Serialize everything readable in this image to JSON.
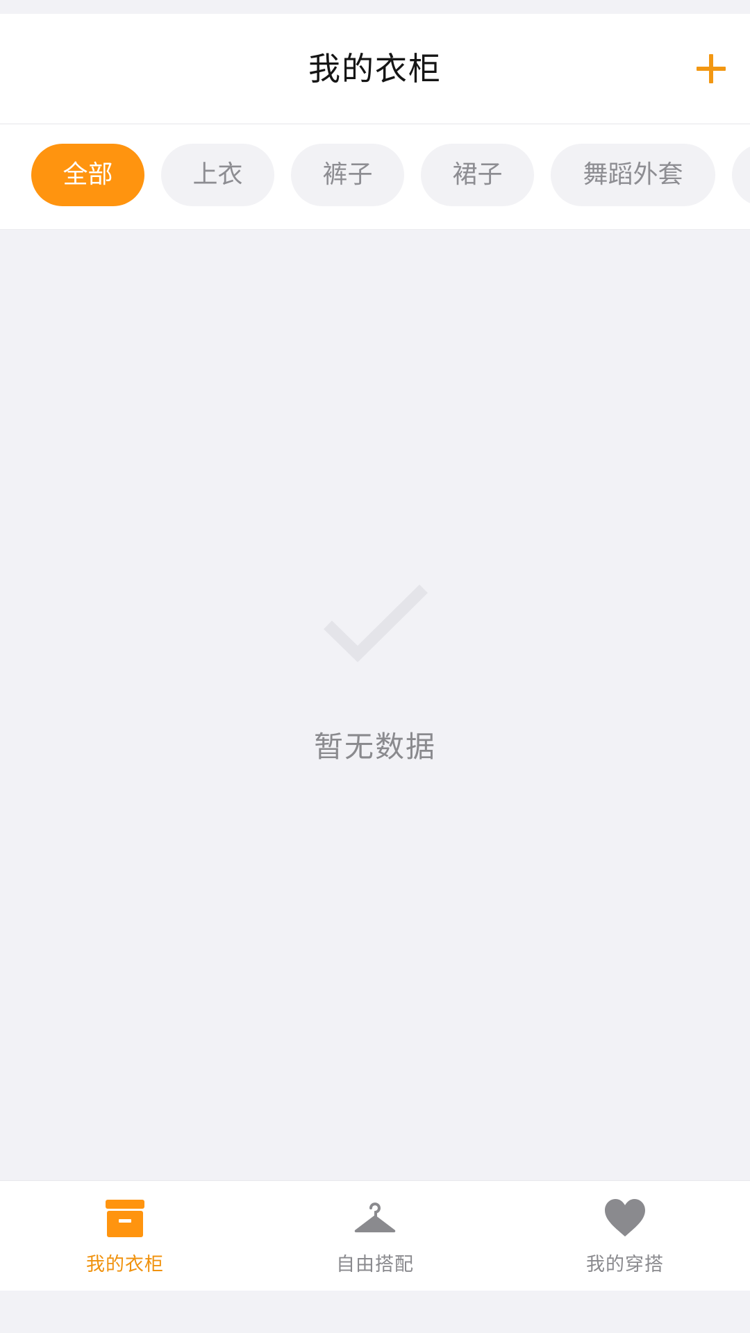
{
  "header": {
    "title": "我的衣柜",
    "add_icon": "plus-icon"
  },
  "categories": [
    {
      "label": "全部",
      "active": true
    },
    {
      "label": "上衣",
      "active": false
    },
    {
      "label": "裤子",
      "active": false
    },
    {
      "label": "裙子",
      "active": false
    },
    {
      "label": "舞蹈外套",
      "active": false
    }
  ],
  "empty_state": {
    "icon": "checkmark-icon",
    "text": "暂无数据"
  },
  "tabbar": {
    "tabs": [
      {
        "label": "我的衣柜",
        "icon": "archive-box-icon",
        "active": true
      },
      {
        "label": "自由搭配",
        "icon": "hanger-icon",
        "active": false
      },
      {
        "label": "我的穿搭",
        "icon": "heart-icon",
        "active": false
      }
    ]
  },
  "colors": {
    "accent": "#ff940f",
    "background": "#f2f2f6",
    "inactive_text": "#8a8a8e",
    "chip_bg": "#f2f2f5"
  }
}
